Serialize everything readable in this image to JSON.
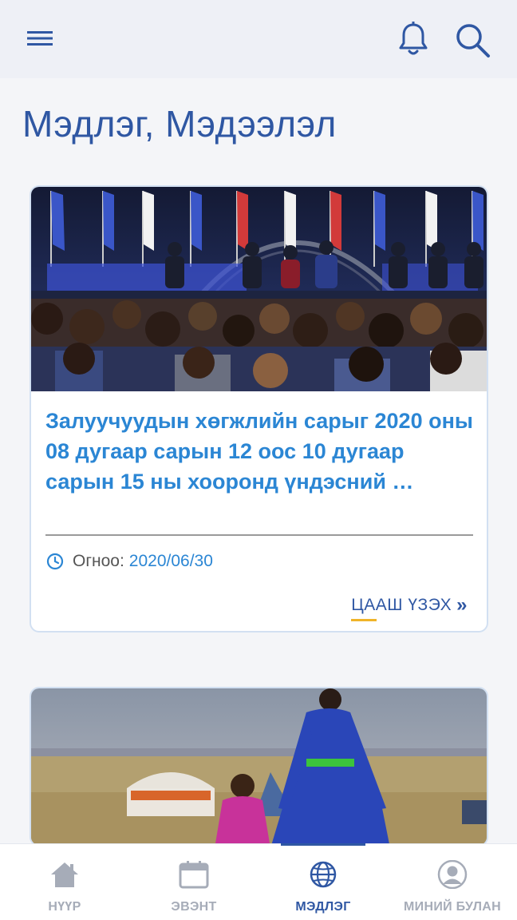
{
  "header": {
    "menu_icon": "hamburger-menu-icon",
    "notification_icon": "bell-icon",
    "search_icon": "search-icon"
  },
  "page": {
    "title": "Мэдлэг, Мэдээлэл"
  },
  "articles": [
    {
      "title": "Залуучуудын хөгжлийн сарыг 2020 оны 08 дугаар сарын 12 оос 10 дугаар сарын 15 ны хооронд үндэсний …",
      "date_label": "Огноо:",
      "date_value": "2020/06/30",
      "read_more": "ЦААШ ҮЗЭХ",
      "read_more_icon": "double-chevron-right-icon",
      "image": "conference-audience-photo"
    },
    {
      "image": "steppe-ger-family-photo"
    }
  ],
  "bottom_nav": {
    "items": [
      {
        "label": "НҮҮР",
        "icon": "home-icon",
        "active": false
      },
      {
        "label": "ЭВЭНТ",
        "icon": "calendar-icon",
        "active": false
      },
      {
        "label": "МЭДЛЭГ",
        "icon": "globe-icon",
        "active": true
      },
      {
        "label": "МИНИЙ БУЛАН",
        "icon": "user-avatar-icon",
        "active": false
      }
    ]
  },
  "colors": {
    "primary": "#2f57a3",
    "link": "#2b86d4",
    "accent": "#f0b429",
    "inactive": "#a6acb8",
    "header_bg": "#eef0f6"
  }
}
